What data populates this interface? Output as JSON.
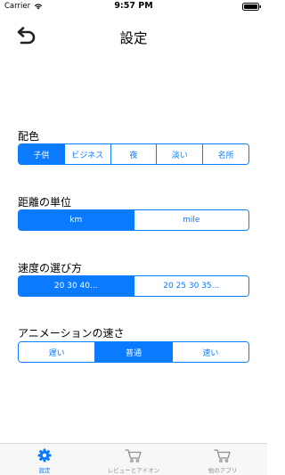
{
  "status": {
    "carrier": "Carrier",
    "time": "9:57 PM"
  },
  "nav": {
    "title": "設定"
  },
  "sections": [
    {
      "label": "配色",
      "options": [
        "子供",
        "ビジネス",
        "夜",
        "淡い",
        "名所"
      ],
      "selected": 0
    },
    {
      "label": "距離の単位",
      "options": [
        "km",
        "mile"
      ],
      "selected": 0
    },
    {
      "label": "速度の選び方",
      "options": [
        "20 30 40...",
        "20 25 30 35..."
      ],
      "selected": 0
    },
    {
      "label": "アニメーションの速さ",
      "options": [
        "遅い",
        "普通",
        "速い"
      ],
      "selected": 1
    }
  ],
  "tabs": [
    {
      "label": "設定",
      "icon": "gear-icon",
      "active": true
    },
    {
      "label": "レビューとアドオン",
      "icon": "cart-icon",
      "active": false
    },
    {
      "label": "他のアプリ",
      "icon": "cart-icon",
      "active": false
    }
  ],
  "colors": {
    "accent": "#0a7aff",
    "tab_inactive": "#8e8e93"
  }
}
